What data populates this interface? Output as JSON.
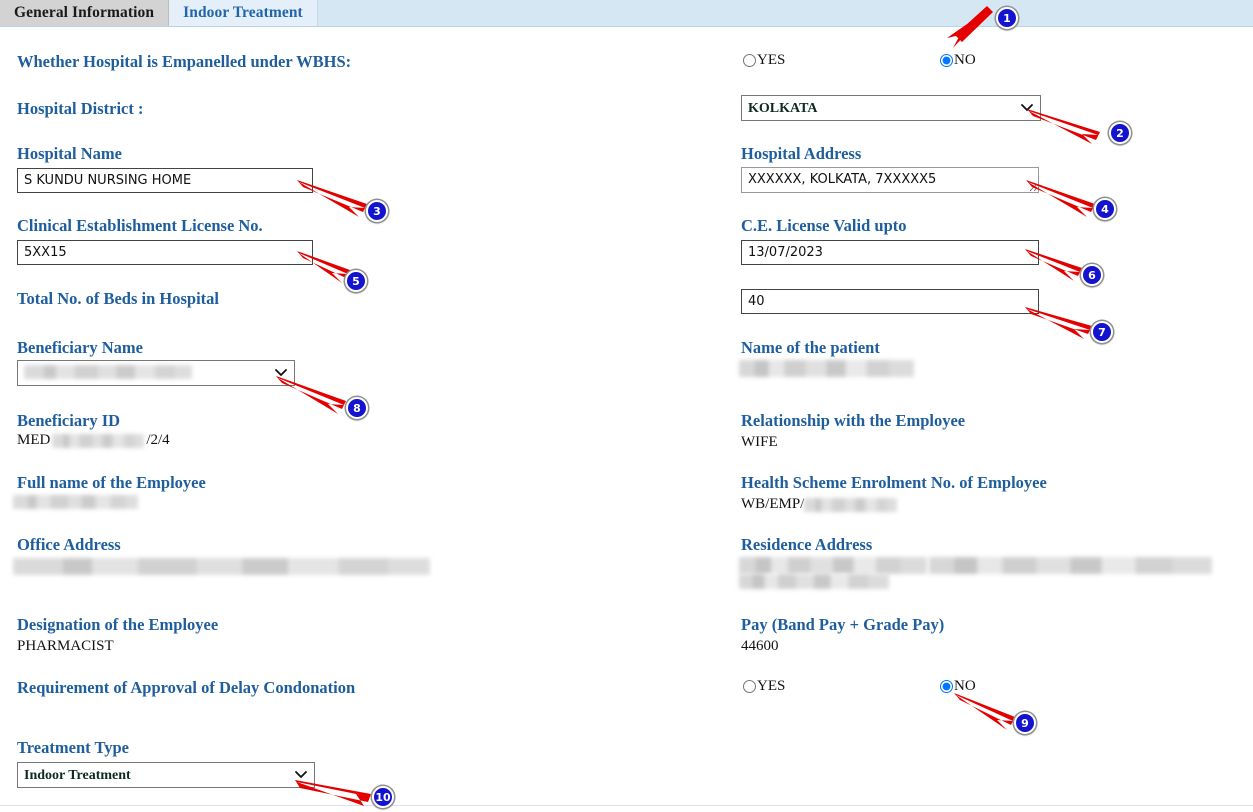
{
  "tabs": [
    {
      "label": "General Information",
      "active": true
    },
    {
      "label": "Indoor Treatment",
      "active": false
    }
  ],
  "form": {
    "empanelled": {
      "label": "Whether Hospital is Empanelled under WBHS:",
      "options": [
        "YES",
        "NO"
      ],
      "selected": "NO"
    },
    "district": {
      "label": "Hospital District :",
      "value": "KOLKATA"
    },
    "hospital_name": {
      "label": "Hospital Name",
      "value": "S KUNDU NURSING HOME"
    },
    "hospital_address": {
      "label": "Hospital Address",
      "value": "XXXXXX, KOLKATA, 7XXXXX5"
    },
    "license_no": {
      "label": "Clinical Establishment License No.",
      "value": "5XX15"
    },
    "license_valid": {
      "label": "C.E. License Valid upto",
      "value": "13/07/2023"
    },
    "total_beds": {
      "label": "Total No. of Beds in Hospital",
      "value": "40"
    },
    "beneficiary_name": {
      "label": "Beneficiary Name",
      "value": "",
      "redacted": true
    },
    "patient_name": {
      "label": "Name of the patient",
      "value": "",
      "redacted": true
    },
    "beneficiary_id": {
      "label": "Beneficiary ID",
      "prefix": "MED",
      "suffix": "/2/4",
      "redacted": true
    },
    "relationship": {
      "label": "Relationship with the Employee",
      "value": "WIFE"
    },
    "employee_full_name": {
      "label": "Full name of the Employee",
      "value": "",
      "redacted": true
    },
    "enrolment_no": {
      "label": "Health Scheme Enrolment No. of Employee",
      "prefix": "WB/EMP/",
      "redacted": true
    },
    "office_address": {
      "label": "Office Address",
      "value": "",
      "redacted": true
    },
    "residence_address": {
      "label": "Residence Address",
      "value": "",
      "redacted": true
    },
    "designation": {
      "label": "Designation of the Employee",
      "value": "PHARMACIST"
    },
    "pay": {
      "label": "Pay (Band Pay + Grade Pay)",
      "value": "44600"
    },
    "delay_condonation": {
      "label": "Requirement of Approval of Delay Condonation",
      "options": [
        "YES",
        "NO"
      ],
      "selected": "NO"
    },
    "treatment_type": {
      "label": "Treatment Type",
      "value": "Indoor Treatment"
    }
  },
  "annotations": {
    "markers": [
      {
        "number": "1"
      },
      {
        "number": "2"
      },
      {
        "number": "3"
      },
      {
        "number": "4"
      },
      {
        "number": "5"
      },
      {
        "number": "6"
      },
      {
        "number": "7"
      },
      {
        "number": "8"
      },
      {
        "number": "9"
      },
      {
        "number": "10"
      }
    ],
    "arrow_color": "#e50000",
    "badge_color": "#1414cf"
  }
}
